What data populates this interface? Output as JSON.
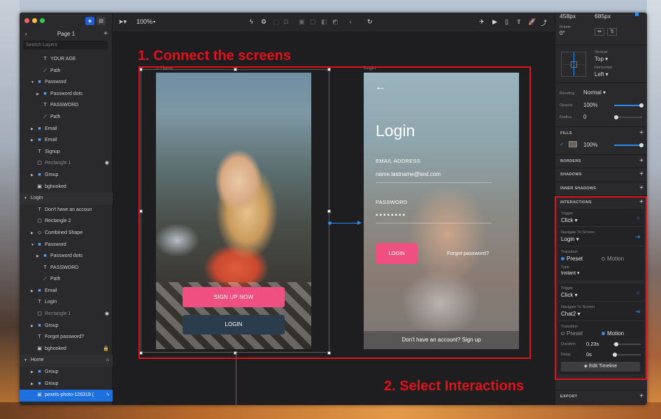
{
  "layers_panel": {
    "page_title": "Page 1",
    "search_placeholder": "Search Layers",
    "items": [
      {
        "label": "YOUR AGE",
        "icon": "T",
        "indent": 3
      },
      {
        "label": "Path",
        "icon": "path",
        "indent": 3
      },
      {
        "label": "Password",
        "icon": "folder",
        "indent": 2,
        "expanded": true
      },
      {
        "label": "Password dots",
        "icon": "folder",
        "indent": 3,
        "collapsed": true
      },
      {
        "label": "PASSWORD",
        "icon": "T",
        "indent": 3
      },
      {
        "label": "Path",
        "icon": "path",
        "indent": 3
      },
      {
        "label": "Email",
        "icon": "folder",
        "indent": 2,
        "collapsed": true
      },
      {
        "label": "Email",
        "icon": "folder",
        "indent": 2,
        "collapsed": true
      },
      {
        "label": "Signup",
        "icon": "T",
        "indent": 2
      },
      {
        "label": "Rectangle 1",
        "icon": "rect",
        "indent": 2,
        "dim": true,
        "badge": "eye"
      },
      {
        "label": "Group",
        "icon": "folder",
        "indent": 2,
        "collapsed": true
      },
      {
        "label": "bghooked",
        "icon": "image",
        "indent": 2
      },
      {
        "label": "Login",
        "icon": "none",
        "indent": 0,
        "group": true,
        "expanded": true
      },
      {
        "label": "Don't have an accoun",
        "icon": "T",
        "indent": 2
      },
      {
        "label": "Rectangle 2",
        "icon": "rect",
        "indent": 2
      },
      {
        "label": "Combined Shape",
        "icon": "shape",
        "indent": 2,
        "collapsed": true
      },
      {
        "label": "Password",
        "icon": "folder",
        "indent": 2,
        "expanded": true
      },
      {
        "label": "Password dots",
        "icon": "folder",
        "indent": 3,
        "collapsed": true
      },
      {
        "label": "PASSWORD",
        "icon": "T",
        "indent": 3
      },
      {
        "label": "Path",
        "icon": "path",
        "indent": 3
      },
      {
        "label": "Email",
        "icon": "folder",
        "indent": 2,
        "collapsed": true
      },
      {
        "label": "Login",
        "icon": "T",
        "indent": 2
      },
      {
        "label": "Rectangle 1",
        "icon": "rect",
        "indent": 2,
        "dim": true,
        "badge": "eye"
      },
      {
        "label": "Group",
        "icon": "folder",
        "indent": 2,
        "collapsed": true
      },
      {
        "label": "Forgot password?",
        "icon": "T",
        "indent": 2
      },
      {
        "label": "bghooked",
        "icon": "image",
        "indent": 2,
        "badge": "lock"
      },
      {
        "label": "Home",
        "icon": "none",
        "indent": 0,
        "group": true,
        "expanded": true,
        "badge": "home"
      },
      {
        "label": "Group",
        "icon": "folder",
        "indent": 2,
        "collapsed": true
      },
      {
        "label": "Group",
        "icon": "folder",
        "indent": 2,
        "collapsed": true
      },
      {
        "label": "pexels-photo-126319 (",
        "icon": "image",
        "indent": 2,
        "selected": true,
        "badge": "bolt"
      }
    ]
  },
  "toolbar": {
    "zoom": "100%"
  },
  "canvas": {
    "home_label": "Home",
    "login_label": "Login",
    "home_screen": {
      "signup_button": "SIGN UP NOW",
      "login_button": "LOGIN"
    },
    "login_screen": {
      "title": "Login",
      "email_label": "EMAIL ADDRESS",
      "email_value": "name.lastname@test.com",
      "password_label": "PASSWORD",
      "password_value": "••••••••",
      "login_button": "LOGIN",
      "forgot": "Forgot password?",
      "signup_footer": "Don't have an account? Sign up"
    },
    "annotation_1": "1. Connect the screens",
    "annotation_2": "2. Select Interactions",
    "annotation_color": "#e3101a"
  },
  "inspector": {
    "width": "458px",
    "height": "685px",
    "rotate_label": "Rotate",
    "rotate_value": "0°",
    "vertical_label": "Vertical",
    "vertical_value": "Top",
    "horizontal_label": "Horizontal",
    "horizontal_value": "Left",
    "blending_label": "Blending",
    "blending_value": "Normal",
    "opacity_label": "Opacity",
    "opacity_value": "100%",
    "opacity_level": 1.0,
    "radius_label": "Radius",
    "radius_value": "0",
    "fills_header": "FILLS",
    "fill_opacity": "100%",
    "borders_header": "BORDERS",
    "shadows_header": "SHADOWS",
    "inner_shadows_header": "INNER SHADOWS",
    "interactions_header": "INTERACTIONS",
    "interaction_1": {
      "trigger_label": "Trigger",
      "trigger_value": "Click",
      "navigate_label": "Navigate To Screen",
      "navigate_value": "Login",
      "transition_label": "Transition",
      "preset": "Preset",
      "motion": "Motion",
      "selected": "Preset",
      "type_label": "Type",
      "type_value": "Instant"
    },
    "interaction_2": {
      "trigger_label": "Trigger",
      "trigger_value": "Click",
      "navigate_label": "Navigate To Screen",
      "navigate_value": "Chat2",
      "transition_label": "Transition",
      "preset": "Preset",
      "motion": "Motion",
      "selected": "Motion",
      "duration_label": "Duration",
      "duration_value": "0.23s",
      "delay_label": "Delay",
      "delay_value": "0s"
    },
    "edit_timeline": "Edit Timeline",
    "export_header": "EXPORT"
  }
}
